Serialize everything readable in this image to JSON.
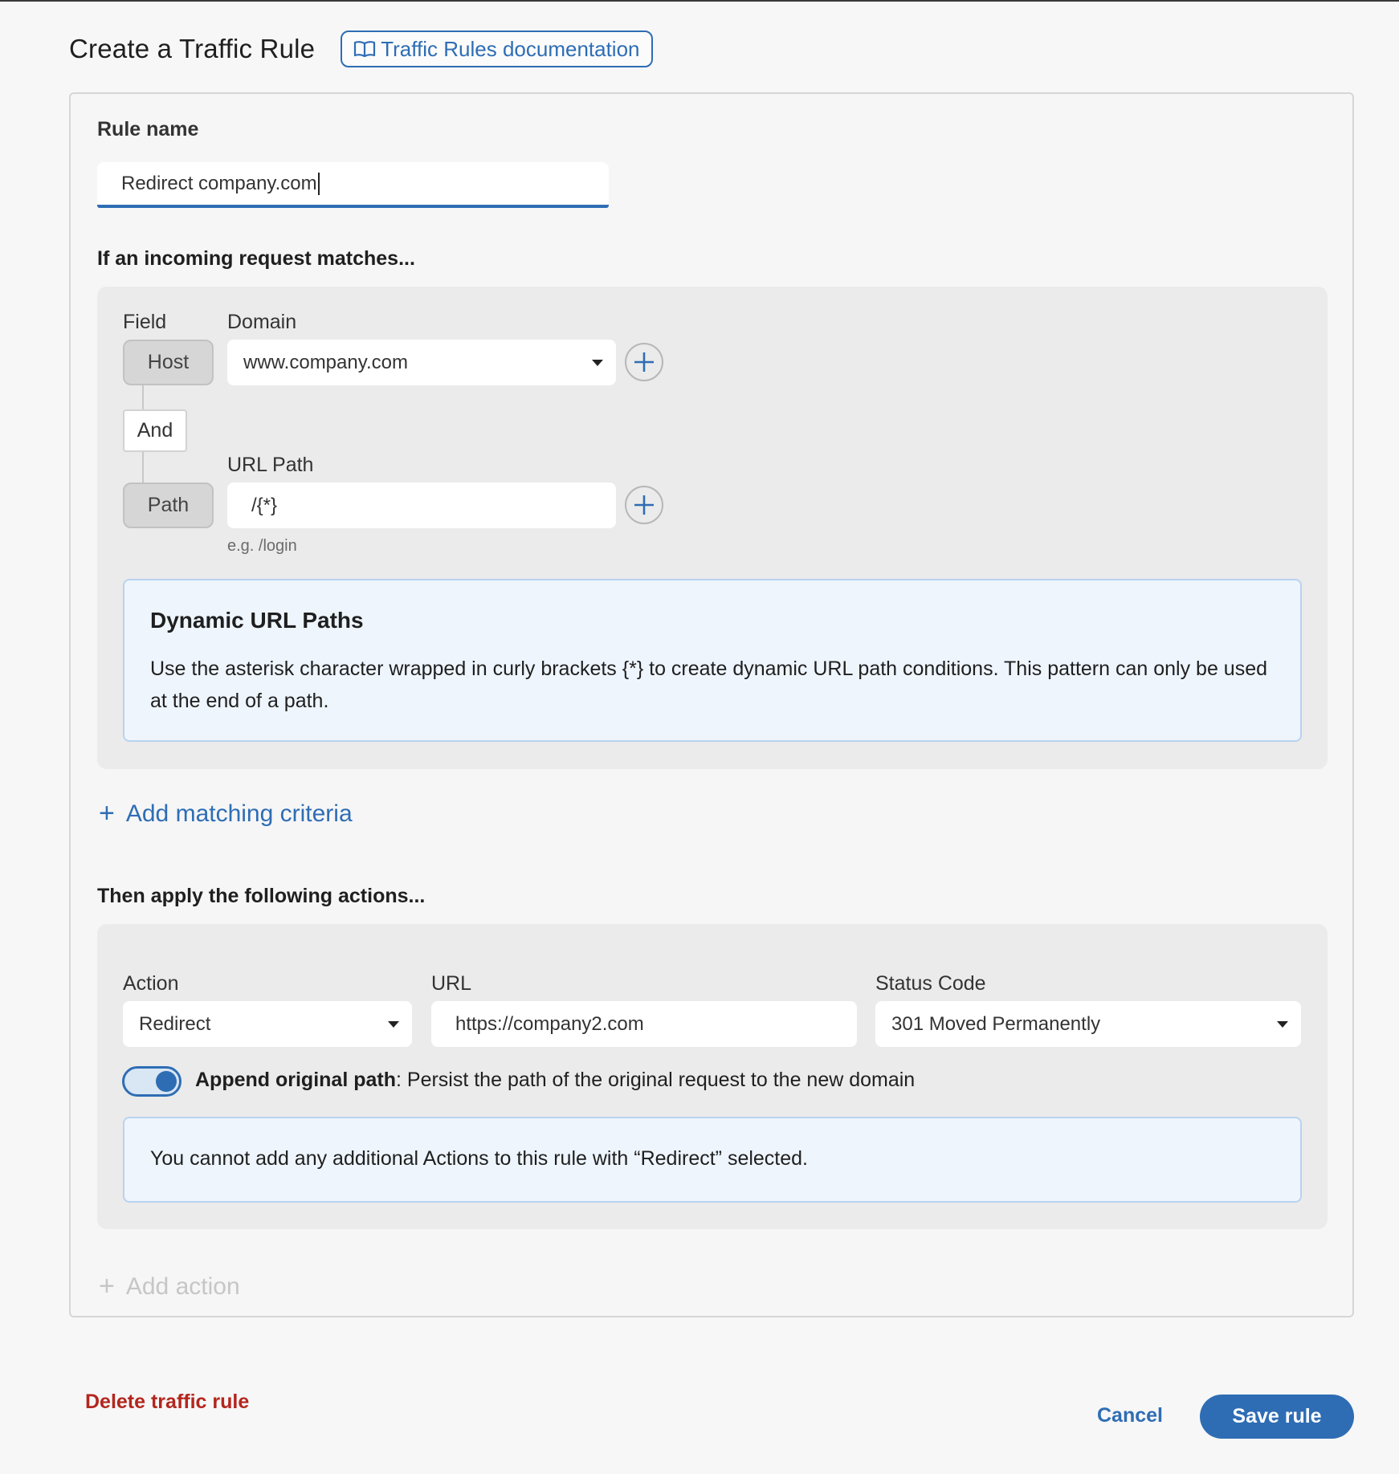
{
  "header": {
    "title": "Create a Traffic Rule",
    "doc_link": "Traffic Rules documentation"
  },
  "rule_name": {
    "label": "Rule name",
    "value": "Redirect company.com"
  },
  "match": {
    "heading": "If an incoming request matches...",
    "field_label": "Field",
    "domain_label": "Domain",
    "host_chip": "Host",
    "domain_value": "www.company.com",
    "and_label": "And",
    "url_path_label": "URL Path",
    "path_chip": "Path",
    "path_value": "/{*}",
    "path_hint": "e.g. /login",
    "info": {
      "title": "Dynamic URL Paths",
      "body": "Use the asterisk character wrapped in curly brackets {*} to create dynamic URL path conditions. This pattern can only be used at the end of a path."
    },
    "add_criteria": "Add matching criteria"
  },
  "actions": {
    "heading": "Then apply the following actions...",
    "action_label": "Action",
    "action_value": "Redirect",
    "url_label": "URL",
    "url_value": "https://company2.com",
    "status_label": "Status Code",
    "status_value": "301 Moved Permanently",
    "toggle_bold": "Append original path",
    "toggle_text": ": Persist the path of the original request to the new domain",
    "toggle_on": true,
    "info": "You cannot add any additional Actions to this rule with “Redirect” selected.",
    "add_action": "Add action"
  },
  "footer": {
    "delete": "Delete traffic rule",
    "cancel": "Cancel",
    "save": "Save rule"
  },
  "colors": {
    "accent": "#2e6db4",
    "danger": "#b3261e",
    "info_bg": "#eef5fd"
  }
}
